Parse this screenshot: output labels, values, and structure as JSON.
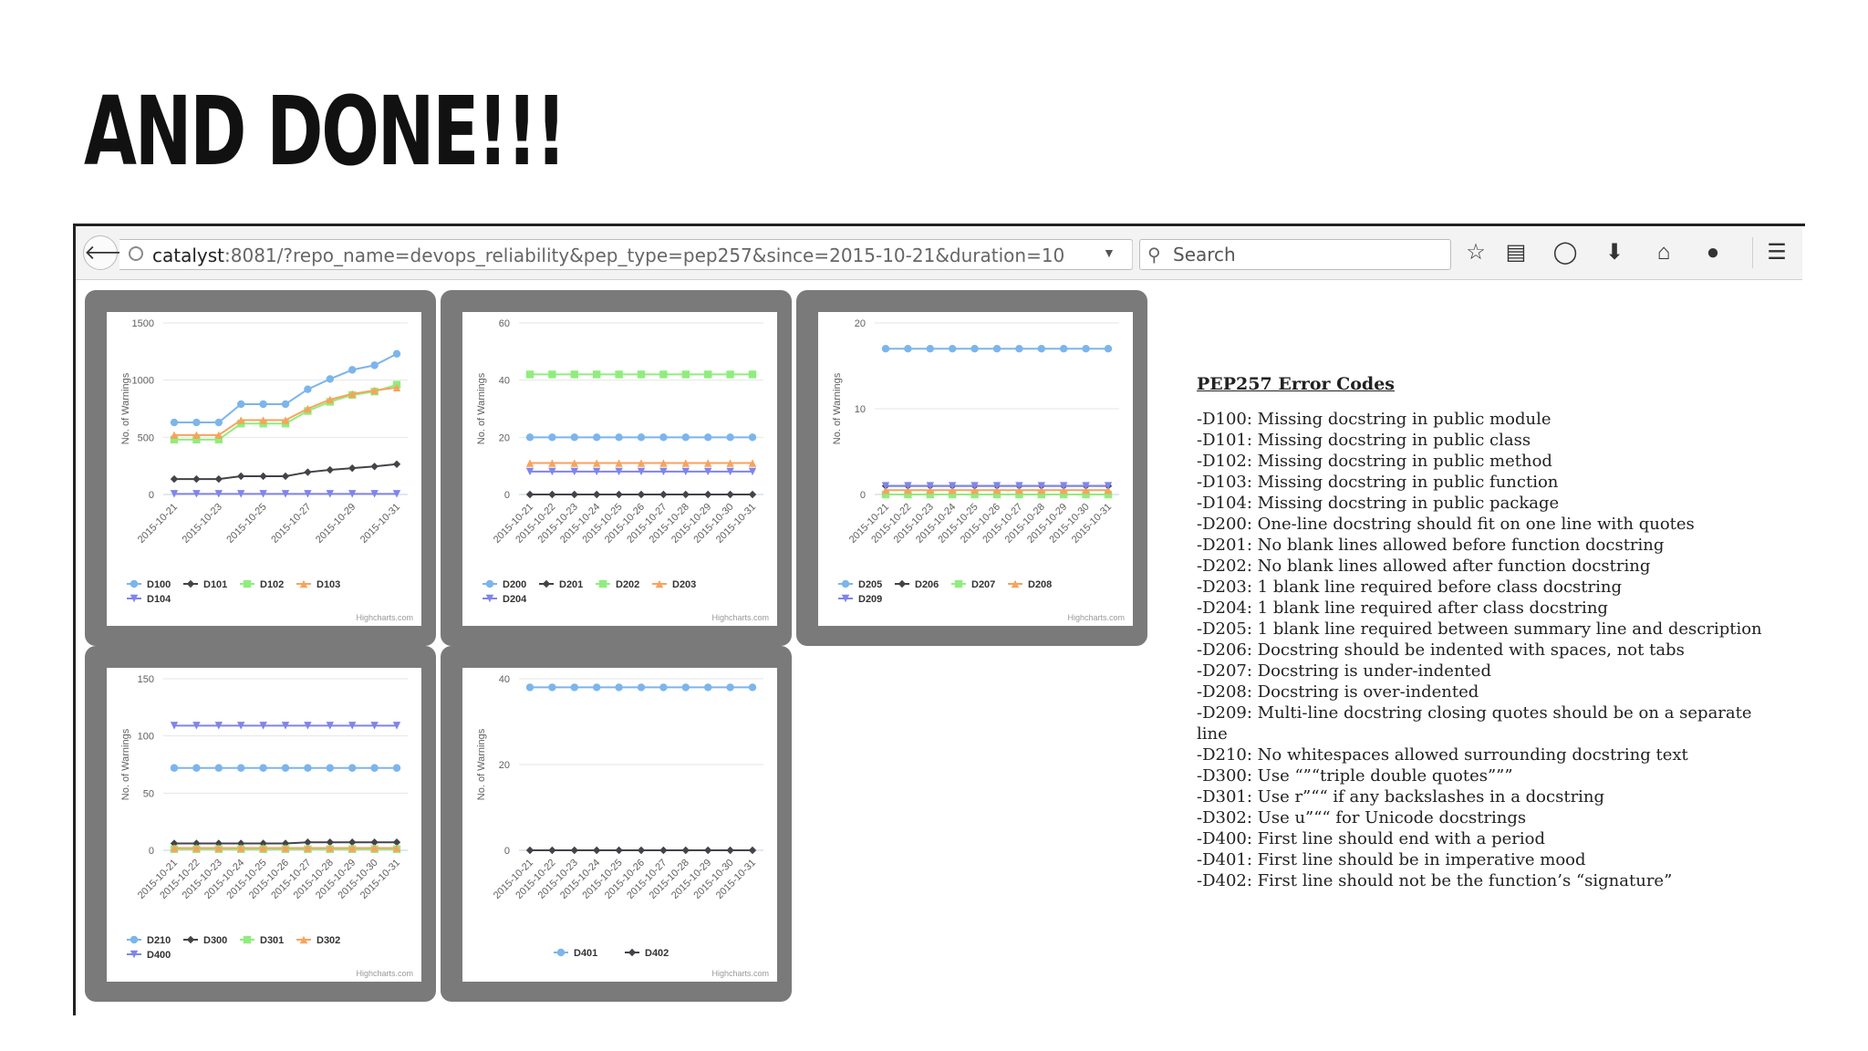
{
  "slide": {
    "title": "AND DONE!!!"
  },
  "browser": {
    "url_host": "catalyst",
    "url_rest": ":8081/?repo_name=devops_reliability&pep_type=pep257&since=2015-10-21&duration=10",
    "search_placeholder": "Search",
    "icons": [
      "star-icon",
      "reading-list-icon",
      "pocket-icon",
      "download-icon",
      "home-icon",
      "chat-icon",
      "menu-icon"
    ]
  },
  "chart_data": [
    {
      "type": "line",
      "y_axis_label": "No. of Warnings",
      "credit": "Highcharts.com",
      "ylim": [
        0,
        1500
      ],
      "yticks": [
        "0",
        "500",
        "1000",
        "1500"
      ],
      "categories": [
        "2015-10-21",
        "2015-10-22",
        "2015-10-23",
        "2015-10-24",
        "2015-10-25",
        "2015-10-26",
        "2015-10-27",
        "2015-10-28",
        "2015-10-29",
        "2015-10-30",
        "2015-10-31"
      ],
      "x_tick_labels": [
        "2015-10-21",
        "",
        "2015-10-23",
        "",
        "2015-10-25",
        "",
        "2015-10-27",
        "",
        "2015-10-29",
        "",
        "2015-10-31"
      ],
      "series": [
        {
          "name": "D100",
          "color": "#7cb5ec",
          "marker": "circle",
          "values": [
            630,
            630,
            630,
            790,
            790,
            790,
            920,
            1010,
            1090,
            1130,
            1230
          ]
        },
        {
          "name": "D101",
          "color": "#434348",
          "marker": "diamond",
          "values": [
            135,
            135,
            135,
            160,
            160,
            160,
            195,
            215,
            230,
            245,
            265
          ]
        },
        {
          "name": "D102",
          "color": "#90ed7d",
          "marker": "square",
          "values": [
            480,
            480,
            480,
            620,
            620,
            620,
            730,
            810,
            870,
            900,
            960
          ]
        },
        {
          "name": "D103",
          "color": "#f7a35c",
          "marker": "triangle",
          "values": [
            520,
            520,
            520,
            650,
            650,
            650,
            750,
            830,
            880,
            910,
            935
          ]
        },
        {
          "name": "D104",
          "color": "#8085e9",
          "marker": "triangle-down",
          "values": [
            5,
            5,
            5,
            5,
            5,
            5,
            5,
            5,
            5,
            5,
            5
          ]
        }
      ]
    },
    {
      "type": "line",
      "y_axis_label": "No. of Warnings",
      "credit": "Highcharts.com",
      "ylim": [
        0,
        60
      ],
      "yticks": [
        "0",
        "20",
        "40",
        "60"
      ],
      "categories": [
        "2015-10-21",
        "2015-10-22",
        "2015-10-23",
        "2015-10-24",
        "2015-10-25",
        "2015-10-26",
        "2015-10-27",
        "2015-10-28",
        "2015-10-29",
        "2015-10-30",
        "2015-10-31"
      ],
      "x_tick_labels": [
        "2015-10-21",
        "2015-10-22",
        "2015-10-23",
        "2015-10-24",
        "2015-10-25",
        "2015-10-26",
        "2015-10-27",
        "2015-10-28",
        "2015-10-29",
        "2015-10-30",
        "2015-10-31"
      ],
      "series": [
        {
          "name": "D200",
          "color": "#7cb5ec",
          "marker": "circle",
          "values": [
            20,
            20,
            20,
            20,
            20,
            20,
            20,
            20,
            20,
            20,
            20
          ]
        },
        {
          "name": "D201",
          "color": "#434348",
          "marker": "diamond",
          "values": [
            0,
            0,
            0,
            0,
            0,
            0,
            0,
            0,
            0,
            0,
            0
          ]
        },
        {
          "name": "D202",
          "color": "#90ed7d",
          "marker": "square",
          "values": [
            42,
            42,
            42,
            42,
            42,
            42,
            42,
            42,
            42,
            42,
            42
          ]
        },
        {
          "name": "D203",
          "color": "#f7a35c",
          "marker": "triangle",
          "values": [
            11,
            11,
            11,
            11,
            11,
            11,
            11,
            11,
            11,
            11,
            11
          ]
        },
        {
          "name": "D204",
          "color": "#8085e9",
          "marker": "triangle-down",
          "values": [
            8,
            8,
            8,
            8,
            8,
            8,
            8,
            8,
            8,
            8,
            8
          ]
        }
      ]
    },
    {
      "type": "line",
      "y_axis_label": "No. of Warnings",
      "credit": "Highcharts.com",
      "ylim": [
        0,
        20
      ],
      "yticks": [
        "0",
        "10",
        "20"
      ],
      "categories": [
        "2015-10-21",
        "2015-10-22",
        "2015-10-23",
        "2015-10-24",
        "2015-10-25",
        "2015-10-26",
        "2015-10-27",
        "2015-10-28",
        "2015-10-29",
        "2015-10-30",
        "2015-10-31"
      ],
      "x_tick_labels": [
        "2015-10-21",
        "2015-10-22",
        "2015-10-23",
        "2015-10-24",
        "2015-10-25",
        "2015-10-26",
        "2015-10-27",
        "2015-10-28",
        "2015-10-29",
        "2015-10-30",
        "2015-10-31"
      ],
      "series": [
        {
          "name": "D205",
          "color": "#7cb5ec",
          "marker": "circle",
          "values": [
            17,
            17,
            17,
            17,
            17,
            17,
            17,
            17,
            17,
            17,
            17
          ]
        },
        {
          "name": "D206",
          "color": "#434348",
          "marker": "diamond",
          "values": [
            1,
            1,
            1,
            1,
            1,
            1,
            1,
            1,
            1,
            1,
            1
          ]
        },
        {
          "name": "D207",
          "color": "#90ed7d",
          "marker": "square",
          "values": [
            0,
            0,
            0,
            0,
            0,
            0,
            0,
            0,
            0,
            0,
            0
          ]
        },
        {
          "name": "D208",
          "color": "#f7a35c",
          "marker": "triangle",
          "values": [
            0.5,
            0.5,
            0.5,
            0.5,
            0.5,
            0.5,
            0.5,
            0.5,
            0.5,
            0.5,
            0.5
          ]
        },
        {
          "name": "D209",
          "color": "#8085e9",
          "marker": "triangle-down",
          "values": [
            1,
            1,
            1,
            1,
            1,
            1,
            1,
            1,
            1,
            1,
            1
          ]
        }
      ]
    },
    {
      "type": "line",
      "y_axis_label": "No. of Warnings",
      "credit": "Highcharts.com",
      "ylim": [
        0,
        150
      ],
      "yticks": [
        "0",
        "50",
        "100",
        "150"
      ],
      "categories": [
        "2015-10-21",
        "2015-10-22",
        "2015-10-23",
        "2015-10-24",
        "2015-10-25",
        "2015-10-26",
        "2015-10-27",
        "2015-10-28",
        "2015-10-29",
        "2015-10-30",
        "2015-10-31"
      ],
      "x_tick_labels": [
        "2015-10-21",
        "2015-10-22",
        "2015-10-23",
        "2015-10-24",
        "2015-10-25",
        "2015-10-26",
        "2015-10-27",
        "2015-10-28",
        "2015-10-29",
        "2015-10-30",
        "2015-10-31"
      ],
      "series": [
        {
          "name": "D210",
          "color": "#7cb5ec",
          "marker": "circle",
          "values": [
            72,
            72,
            72,
            72,
            72,
            72,
            72,
            72,
            72,
            72,
            72
          ]
        },
        {
          "name": "D300",
          "color": "#434348",
          "marker": "diamond",
          "values": [
            6,
            6,
            6,
            6,
            6,
            6,
            7,
            7,
            7,
            7,
            7
          ]
        },
        {
          "name": "D301",
          "color": "#90ed7d",
          "marker": "square",
          "values": [
            1,
            1,
            1,
            1,
            1,
            1,
            1,
            1,
            1,
            1,
            1
          ]
        },
        {
          "name": "D302",
          "color": "#f7a35c",
          "marker": "triangle",
          "values": [
            2,
            2,
            2,
            2,
            2,
            2,
            2,
            2,
            2,
            2,
            2
          ]
        },
        {
          "name": "D400",
          "color": "#8085e9",
          "marker": "triangle-down",
          "values": [
            109,
            109,
            109,
            109,
            109,
            109,
            109,
            109,
            109,
            109,
            109
          ]
        }
      ]
    },
    {
      "type": "line",
      "y_axis_label": "No. of Warnings",
      "credit": "Highcharts.com",
      "ylim": [
        0,
        40
      ],
      "yticks": [
        "0",
        "20",
        "40"
      ],
      "categories": [
        "2015-10-21",
        "2015-10-22",
        "2015-10-23",
        "2015-10-24",
        "2015-10-25",
        "2015-10-26",
        "2015-10-27",
        "2015-10-28",
        "2015-10-29",
        "2015-10-30",
        "2015-10-31"
      ],
      "x_tick_labels": [
        "2015-10-21",
        "2015-10-22",
        "2015-10-23",
        "2015-10-24",
        "2015-10-25",
        "2015-10-26",
        "2015-10-27",
        "2015-10-28",
        "2015-10-29",
        "2015-10-30",
        "2015-10-31"
      ],
      "series": [
        {
          "name": "D401",
          "color": "#7cb5ec",
          "marker": "circle",
          "values": [
            38,
            38,
            38,
            38,
            38,
            38,
            38,
            38,
            38,
            38,
            38
          ]
        },
        {
          "name": "D402",
          "color": "#434348",
          "marker": "diamond",
          "values": [
            0,
            0,
            0,
            0,
            0,
            0,
            0,
            0,
            0,
            0,
            0
          ]
        }
      ]
    }
  ],
  "legend": {
    "title": "PEP257 Error Codes",
    "lines": [
      "-D100: Missing docstring in public module",
      "-D101: Missing docstring in public class",
      "-D102: Missing docstring in public method",
      "-D103: Missing docstring in public function",
      "-D104: Missing docstring in public package",
      "-D200: One-line docstring should fit on one line with quotes",
      "-D201: No blank lines allowed before function docstring",
      "-D202: No blank lines allowed after function docstring",
      "-D203: 1 blank line required before class docstring",
      "-D204: 1 blank line required after class docstring",
      "-D205: 1 blank line required between summary line and description",
      "-D206: Docstring should be indented with spaces, not tabs",
      "-D207: Docstring is under-indented",
      "-D208: Docstring is over-indented",
      "-D209: Multi-line docstring closing quotes should be on a separate",
      "line",
      "-D210: No whitespaces allowed surrounding docstring text",
      "-D300: Use “”“triple double quotes”””",
      "-D301: Use r”““ if any backslashes in a docstring",
      "-D302: Use u”““ for Unicode docstrings",
      "-D400: First line should end with a period",
      "-D401: First line should be in imperative mood",
      "-D402: First line should not be the function’s “signature”"
    ]
  }
}
